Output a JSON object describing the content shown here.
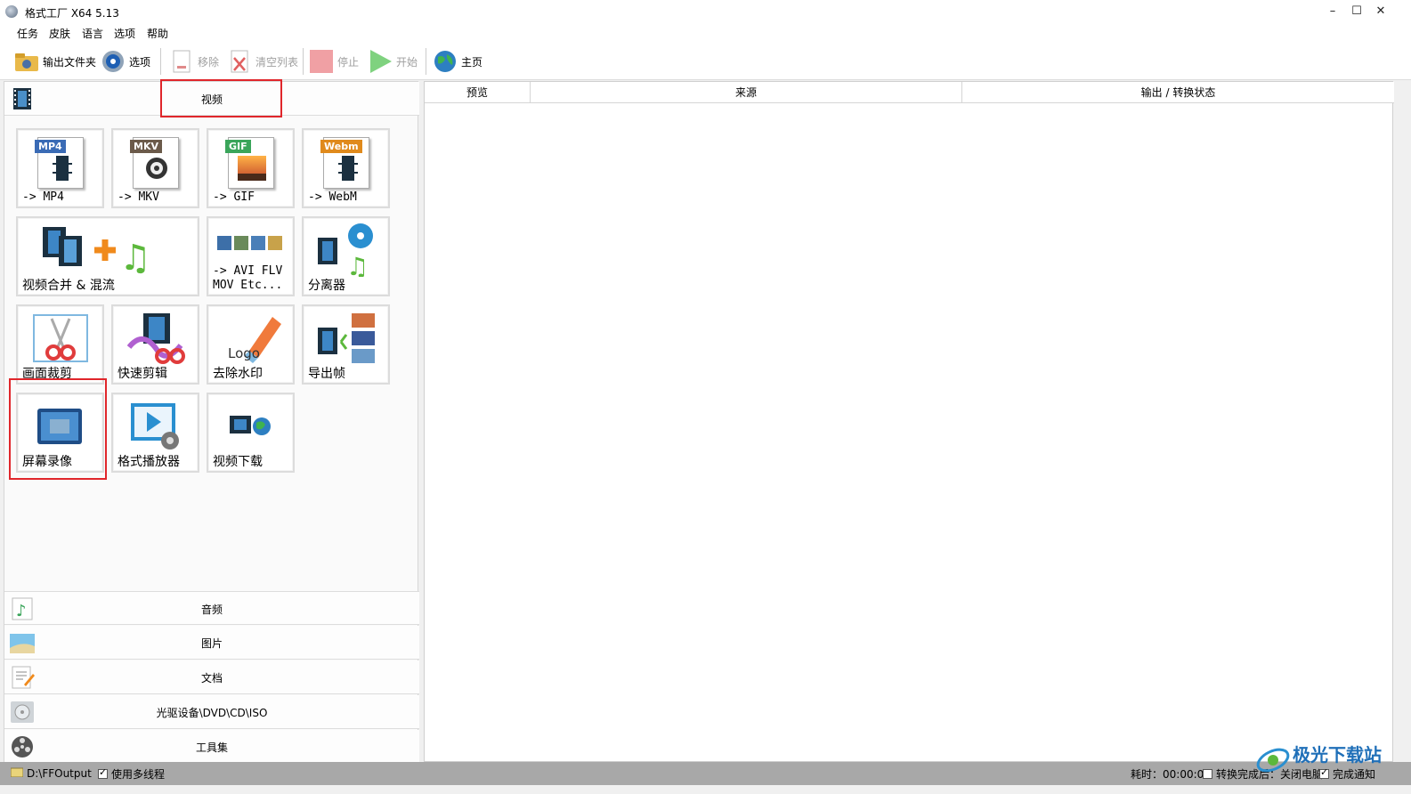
{
  "window": {
    "title": "格式工厂 X64 5.13",
    "controls": [
      "–",
      "☐",
      "✕"
    ]
  },
  "menu": [
    "任务",
    "皮肤",
    "语言",
    "选项",
    "帮助"
  ],
  "toolbar": {
    "output_folder": "输出文件夹",
    "options": "选项",
    "remove": "移除",
    "clear_list": "清空列表",
    "stop": "停止",
    "start": "开始",
    "home": "主页"
  },
  "categories": {
    "video": "视频",
    "audio": "音频",
    "image": "图片",
    "document": "文档",
    "disc": "光驱设备\\DVD\\CD\\ISO",
    "tools": "工具集"
  },
  "video_tools": [
    {
      "badge": "MP4",
      "label": "-> MP4",
      "badge_color": "#3a6bb5"
    },
    {
      "badge": "MKV",
      "label": "-> MKV",
      "badge_color": "#6b5a4a"
    },
    {
      "badge": "GIF",
      "label": "-> GIF",
      "badge_color": "#3aa55a"
    },
    {
      "badge": "Webm",
      "label": "-> WebM",
      "badge_color": "#e08a1c"
    },
    {
      "label": "视频合并 & 混流"
    },
    {
      "label": "-> AVI FLV\nMOV Etc..."
    },
    {
      "label": "分离器"
    },
    {
      "label": "画面裁剪"
    },
    {
      "label": "快速剪辑"
    },
    {
      "label": "去除水印"
    },
    {
      "label": "导出帧"
    },
    {
      "label": "屏幕录像"
    },
    {
      "label": "格式播放器"
    },
    {
      "label": "视频下载"
    }
  ],
  "logo_text": "Logo",
  "file_list": {
    "columns": [
      "预览",
      "来源",
      "输出 / 转换状态"
    ]
  },
  "status": {
    "output_path": "D:\\FFOutput",
    "multithread": "使用多线程",
    "elapsed": "耗时：00:00:00",
    "after_convert": "转换完成后：关闭电脑",
    "notify": "完成通知"
  },
  "watermark": "极光下载站",
  "colors": {
    "highlight": "#e0262b",
    "statusbar": "#a8a8a8"
  }
}
